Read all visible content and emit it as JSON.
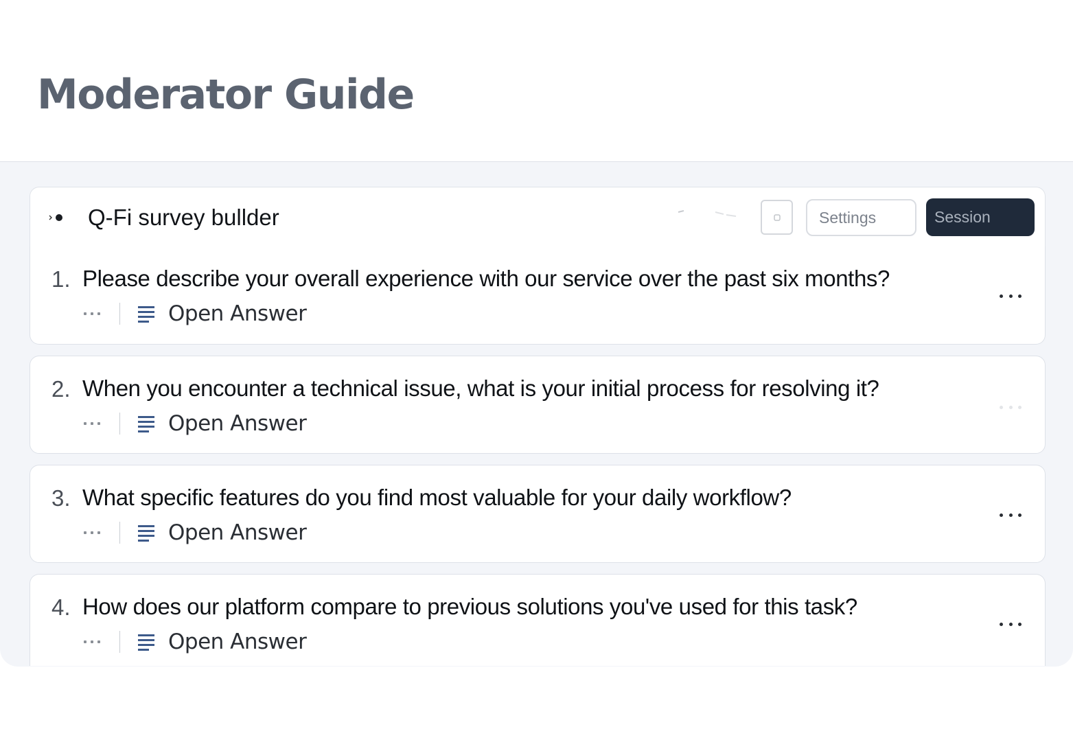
{
  "page": {
    "title": "Moderator Guide"
  },
  "builder": {
    "title": "Q-Fi survey bullder",
    "logo_icon": "logo-icon",
    "square_button_icon": "square-icon",
    "settings_label": "Settings",
    "session_label": "Session",
    "colors": {
      "session_bg": "#1f2a3a",
      "panel_bg": "#f3f5f9",
      "lines_icon": "#3d5a8a"
    }
  },
  "questions": [
    {
      "number": "1.",
      "text": "Please describe your overall experience with our service over the past six months?",
      "answer_type": "Open Answer",
      "answer_icon": "text-lines-icon",
      "more_icon": "more-dots-icon"
    },
    {
      "number": "2.",
      "text": "When you encounter a technical issue, what is your initial process for resolving it?",
      "answer_type": "Open Answer",
      "answer_icon": "text-lines-icon",
      "more_icon": "more-dots-icon"
    },
    {
      "number": "3.",
      "text": "What specific features do you find most valuable for your daily workflow?",
      "answer_type": "Open Answer",
      "answer_icon": "text-lines-icon",
      "more_icon": "more-dots-icon"
    },
    {
      "number": "4.",
      "text": "How does our platform compare to previous solutions you've used for this task?",
      "answer_type": "Open Answer",
      "answer_icon": "text-lines-icon",
      "more_icon": "more-dots-icon"
    }
  ]
}
